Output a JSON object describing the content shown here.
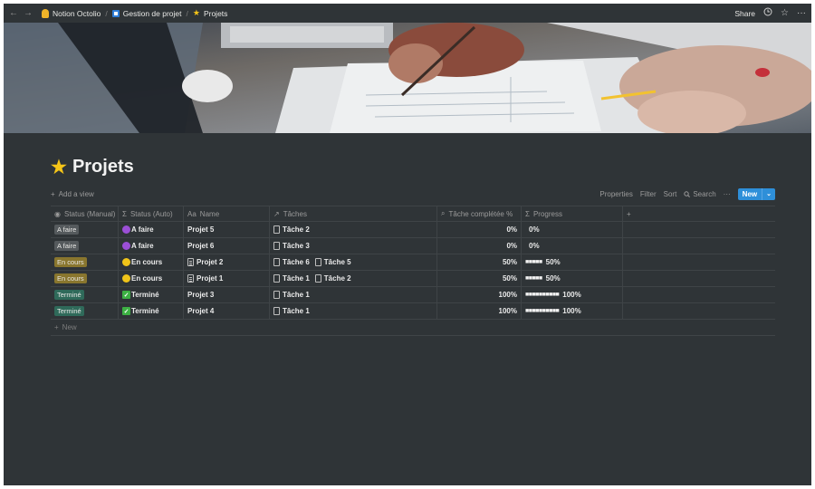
{
  "topbar": {
    "back": "←",
    "forward": "→",
    "breadcrumbs": [
      "Notion Octolio",
      "Gestion de projet",
      "Projets"
    ],
    "separator": "/",
    "share": "Share",
    "clock_icon": "clock-icon",
    "star_icon": "star-icon",
    "more": "···"
  },
  "page": {
    "title": "Projets",
    "emoji": "★"
  },
  "viewbar": {
    "add_view": "Add a view",
    "properties": "Properties",
    "filter": "Filter",
    "sort": "Sort",
    "search": "Search",
    "more": "···",
    "new": "New"
  },
  "table": {
    "columns": [
      "Status (Manual)",
      "Status (Auto)",
      "Name",
      "Tâches",
      "Tâche complétée %",
      "Progress",
      "+"
    ],
    "rows": [
      {
        "manual": "A faire",
        "manual_color": "gray",
        "auto": "A faire",
        "auto_icon": "purple",
        "name": "Projet 5",
        "name_doc": false,
        "tasks": [
          "Tâche 2"
        ],
        "pct": "0%",
        "bar": "",
        "progress": "0%"
      },
      {
        "manual": "A faire",
        "manual_color": "gray",
        "auto": "A faire",
        "auto_icon": "purple",
        "name": "Projet 6",
        "name_doc": false,
        "tasks": [
          "Tâche 3"
        ],
        "pct": "0%",
        "bar": "",
        "progress": "0%"
      },
      {
        "manual": "En cours",
        "manual_color": "yellow",
        "auto": "En cours",
        "auto_icon": "yellow",
        "name": "Projet 2",
        "name_doc": true,
        "tasks": [
          "Tâche 6",
          "Tâche 5"
        ],
        "pct": "50%",
        "bar": "■■■■■",
        "progress": "50%"
      },
      {
        "manual": "En cours",
        "manual_color": "yellow",
        "auto": "En cours",
        "auto_icon": "yellow",
        "name": "Projet 1",
        "name_doc": true,
        "tasks": [
          "Tâche 1",
          "Tâche 2"
        ],
        "pct": "50%",
        "bar": "■■■■■",
        "progress": "50%"
      },
      {
        "manual": "Terminé",
        "manual_color": "green",
        "auto": "Terminé",
        "auto_icon": "check",
        "name": "Projet 3",
        "name_doc": false,
        "tasks": [
          "Tâche 1"
        ],
        "pct": "100%",
        "bar": "■■■■■■■■■■",
        "progress": "100%"
      },
      {
        "manual": "Terminé",
        "manual_color": "green",
        "auto": "Terminé",
        "auto_icon": "check",
        "name": "Projet 4",
        "name_doc": false,
        "tasks": [
          "Tâche 1"
        ],
        "pct": "100%",
        "bar": "■■■■■■■■■■",
        "progress": "100%"
      }
    ],
    "new_row": "New"
  },
  "colors": {
    "background": "#2f3437",
    "accent": "#2e8fd9"
  }
}
